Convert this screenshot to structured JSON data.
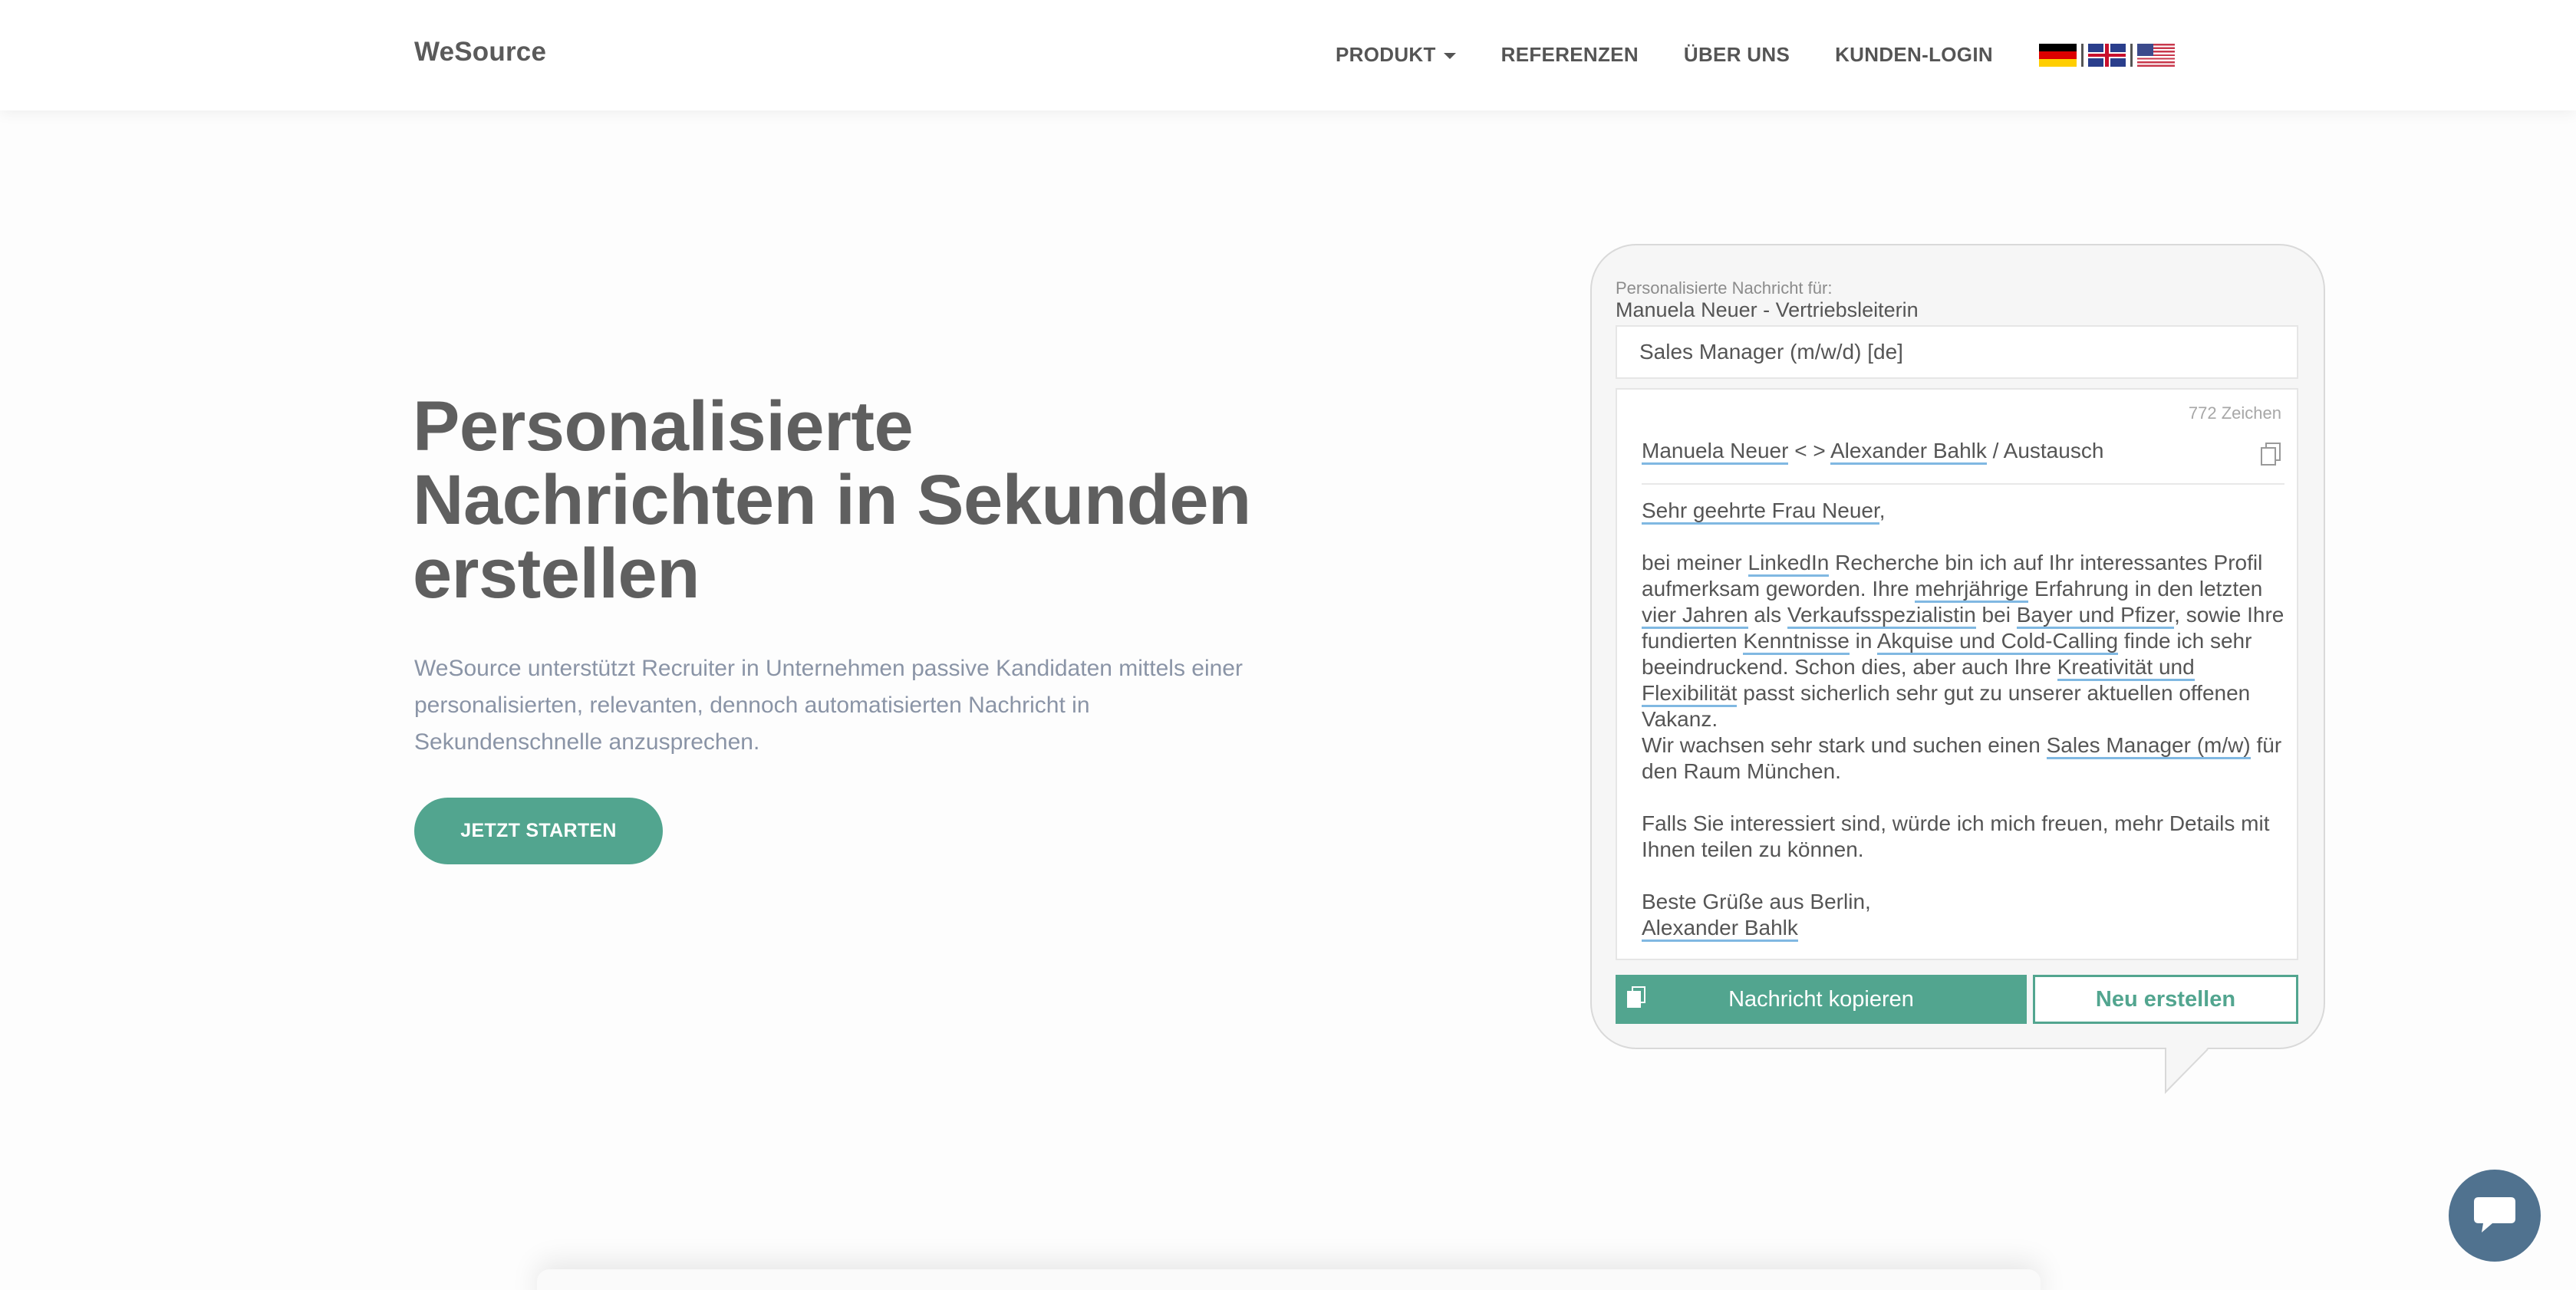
{
  "brand": "WeSource",
  "nav": {
    "items": [
      {
        "label": "PRODUKT",
        "dropdown": true
      },
      {
        "label": "REFERENZEN"
      },
      {
        "label": "ÜBER UNS"
      },
      {
        "label": "KUNDEN-LOGIN"
      }
    ],
    "flags": [
      "german-flag",
      "uk-flag",
      "us-flag"
    ]
  },
  "hero": {
    "title_line1": "Personalisierte",
    "title_line2": "Nachrichten in Sekunden",
    "title_line3": "erstellen",
    "subtitle": "WeSource unterstützt Recruiter in Unternehmen passive Kandidaten mittels einer personalisierten, relevanten, dennoch automatisierten Nachricht in Sekundenschnelle anzusprechen.",
    "cta_label": "JETZT STARTEN"
  },
  "mockup": {
    "label": "Personalisierte Nachricht für:",
    "recipient": "Manuela Neuer - Vertriebsleiterin",
    "job_selected": "Sales Manager (m/w/d) [de]",
    "char_count": "772 Zeichen",
    "subject": {
      "name1": "Manuela Neuer",
      "sep": " < > ",
      "name2": "Alexander Bahlk",
      "tail": " / Austausch"
    },
    "body": {
      "greeting": "Sehr geehrte Frau Neuer",
      "greeting_punct": ",",
      "p1_a": "bei meiner ",
      "p1_linkedin": "LinkedIn",
      "p1_b": " Recherche bin ich auf Ihr interessantes Profil aufmerksam geworden. Ihre ",
      "p1_mehrj": "mehrjährige",
      "p1_c": " Erfahrung in den letzten ",
      "p1_vier": "vier Jahren",
      "p1_d": " als ",
      "p1_verk": "Verkaufsspezialistin",
      "p1_e": " bei ",
      "p1_bayer": "Bayer und Pfizer",
      "p1_f": ", sowie Ihre fundierten ",
      "p1_kennt": "Kenntnisse",
      "p1_g": " in ",
      "p1_akq": "Akquise und Cold-Calling",
      "p1_h": " finde ich sehr beeindruckend. Schon dies, aber auch Ihre ",
      "p1_krea": "Kreativität und Flexibilität",
      "p1_i": " passt sicherlich sehr gut zu unserer aktuellen offenen Vakanz.",
      "p2_a": "Wir wachsen sehr stark und suchen einen ",
      "p2_job": "Sales Manager (m/w)",
      "p2_b": " für den Raum München.",
      "p3": "Falls Sie interessiert sind, würde ich mich freuen, mehr Details mit Ihnen teilen zu können.",
      "closing": "Beste Grüße aus Berlin,",
      "signature": "Alexander Bahlk"
    },
    "copy_button": "Nachricht kopieren",
    "new_button": "Neu erstellen"
  },
  "colors": {
    "accent": "#52a58f",
    "chat": "#50728f",
    "underline": "#80b8e2"
  },
  "icons": [
    "copy-icon",
    "chat-icon",
    "caret-down-icon"
  ]
}
